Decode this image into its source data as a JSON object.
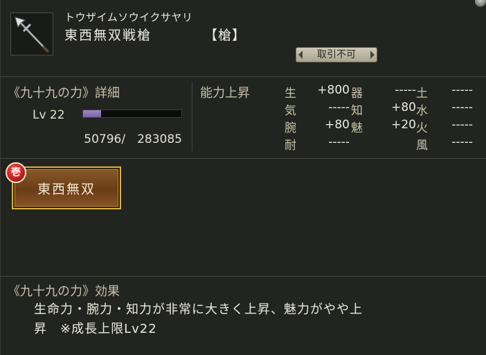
{
  "item": {
    "reading": "トウザイムソウイクサヤリ",
    "name": "東西無双戦槍",
    "type": "【槍】",
    "trade_status": "取引不可",
    "icon": "spear-icon"
  },
  "power": {
    "title": "《九十九の力》詳細",
    "level_label": "Lv 22",
    "exp_text": "50796/　283085",
    "exp_current": 50796,
    "exp_max": 283085,
    "bar_fill_ratio": 0.18,
    "bar_color": "#9a80c4"
  },
  "ability": {
    "title": "能力上昇",
    "stats": [
      {
        "label": "生",
        "value": "+800"
      },
      {
        "label": "気",
        "value": "-----"
      },
      {
        "label": "腕",
        "value": "+80"
      },
      {
        "label": "耐",
        "value": "-----"
      },
      {
        "label": "器",
        "value": "-----"
      },
      {
        "label": "知",
        "value": "+80"
      },
      {
        "label": "魅",
        "value": "+20"
      },
      {
        "label": "土",
        "value": "-----"
      },
      {
        "label": "水",
        "value": "-----"
      },
      {
        "label": "火",
        "value": "-----"
      },
      {
        "label": "風",
        "value": "-----"
      }
    ]
  },
  "skill": {
    "seal": "壱",
    "name": "東西無双",
    "seal_color": "#c81e1e",
    "frame_color": "#d7b047"
  },
  "effect": {
    "title": "《九十九の力》効果",
    "line1": "生命力・腕力・知力が非常に大きく上昇、魅力がやや上",
    "line2": "昇　※成長上限Lv22"
  }
}
